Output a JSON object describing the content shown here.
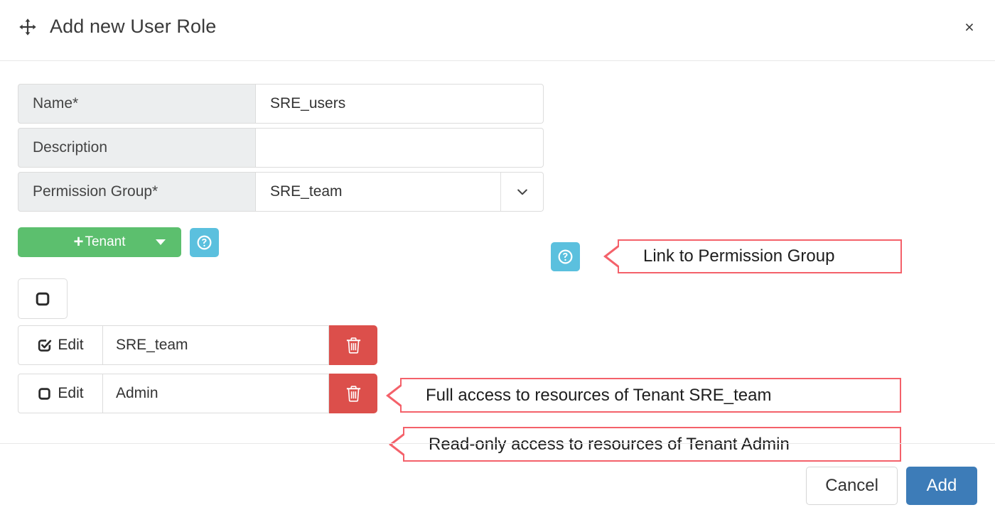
{
  "header": {
    "title": "Add new User Role",
    "move_icon": "arrows-move-icon",
    "close_label": "×"
  },
  "form": {
    "fields": [
      {
        "label": "Name*",
        "value": "SRE_users",
        "type": "text"
      },
      {
        "label": "Description",
        "value": "",
        "type": "text"
      },
      {
        "label": "Permission Group*",
        "value": "SRE_team",
        "type": "select"
      }
    ],
    "help_icon": "question-circle-icon"
  },
  "tenant_button": {
    "plus": "+",
    "label": "Tenant",
    "caret_icon": "caret-down-icon",
    "color": "#5cbf6e",
    "help_icon": "question-circle-icon"
  },
  "select_all": {
    "icon": "checkbox-unchecked-icon",
    "checked": false
  },
  "tenant_rows": [
    {
      "edit_label": "Edit",
      "checkbox_icon": "checkbox-checked-icon",
      "checked": true,
      "name": "SRE_team",
      "delete_icon": "trash-icon"
    },
    {
      "edit_label": "Edit",
      "checkbox_icon": "checkbox-unchecked-icon",
      "checked": false,
      "name": "Admin",
      "delete_icon": "trash-icon"
    }
  ],
  "annotations": [
    {
      "id": "permission-group",
      "text": "Link to Permission Group"
    },
    {
      "id": "row-0",
      "text": "Full access to resources of Tenant SRE_team"
    },
    {
      "id": "row-1",
      "text": "Read-only access to resources of Tenant Admin"
    }
  ],
  "footer": {
    "cancel_label": "Cancel",
    "add_label": "Add"
  },
  "colors": {
    "accent_blue": "#3d7cb8",
    "help_blue": "#5bc0de",
    "tenant_green": "#5cbf6e",
    "danger_red": "#dc4f4b",
    "annotation_border": "#f4616a",
    "label_bg": "#eceeef"
  }
}
